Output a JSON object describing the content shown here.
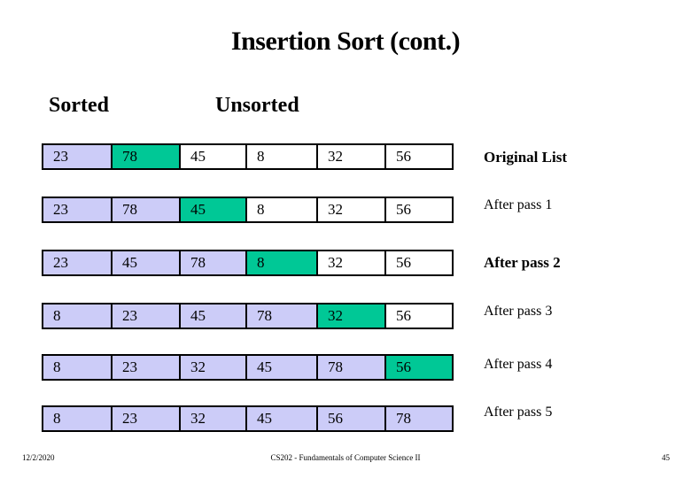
{
  "title": "Insertion Sort (cont.)",
  "column_labels": {
    "sorted": "Sorted",
    "unsorted": "Unsorted"
  },
  "colors": {
    "sorted": "#ccccf8",
    "current": "#00c896",
    "unsorted": "#ffffff"
  },
  "rows": [
    {
      "label": "Original List",
      "label_bold": true,
      "cells": [
        {
          "value": "23",
          "state": "sorted"
        },
        {
          "value": "78",
          "state": "current"
        },
        {
          "value": "45",
          "state": "unsorted"
        },
        {
          "value": "8",
          "state": "unsorted"
        },
        {
          "value": "32",
          "state": "unsorted"
        },
        {
          "value": "56",
          "state": "unsorted"
        }
      ]
    },
    {
      "label": "After pass 1",
      "label_bold": false,
      "cells": [
        {
          "value": "23",
          "state": "sorted"
        },
        {
          "value": "78",
          "state": "sorted"
        },
        {
          "value": "45",
          "state": "current"
        },
        {
          "value": "8",
          "state": "unsorted"
        },
        {
          "value": "32",
          "state": "unsorted"
        },
        {
          "value": "56",
          "state": "unsorted"
        }
      ]
    },
    {
      "label": "After pass 2",
      "label_bold": true,
      "cells": [
        {
          "value": "23",
          "state": "sorted"
        },
        {
          "value": "45",
          "state": "sorted"
        },
        {
          "value": "78",
          "state": "sorted"
        },
        {
          "value": "8",
          "state": "current"
        },
        {
          "value": "32",
          "state": "unsorted"
        },
        {
          "value": "56",
          "state": "unsorted"
        }
      ]
    },
    {
      "label": "After pass 3",
      "label_bold": false,
      "cells": [
        {
          "value": "8",
          "state": "sorted"
        },
        {
          "value": "23",
          "state": "sorted"
        },
        {
          "value": "45",
          "state": "sorted"
        },
        {
          "value": "78",
          "state": "sorted"
        },
        {
          "value": "32",
          "state": "current"
        },
        {
          "value": "56",
          "state": "unsorted"
        }
      ]
    },
    {
      "label": "After pass 4",
      "label_bold": false,
      "cells": [
        {
          "value": "8",
          "state": "sorted"
        },
        {
          "value": "23",
          "state": "sorted"
        },
        {
          "value": "32",
          "state": "sorted"
        },
        {
          "value": "45",
          "state": "sorted"
        },
        {
          "value": "78",
          "state": "sorted"
        },
        {
          "value": "56",
          "state": "current"
        }
      ]
    },
    {
      "label": "After pass 5",
      "label_bold": false,
      "cells": [
        {
          "value": "8",
          "state": "sorted"
        },
        {
          "value": "23",
          "state": "sorted"
        },
        {
          "value": "32",
          "state": "sorted"
        },
        {
          "value": "45",
          "state": "sorted"
        },
        {
          "value": "56",
          "state": "sorted"
        },
        {
          "value": "78",
          "state": "sorted"
        }
      ]
    }
  ],
  "footer": {
    "date": "12/2/2020",
    "course": "CS202 - Fundamentals of Computer Science II",
    "page": "45"
  }
}
